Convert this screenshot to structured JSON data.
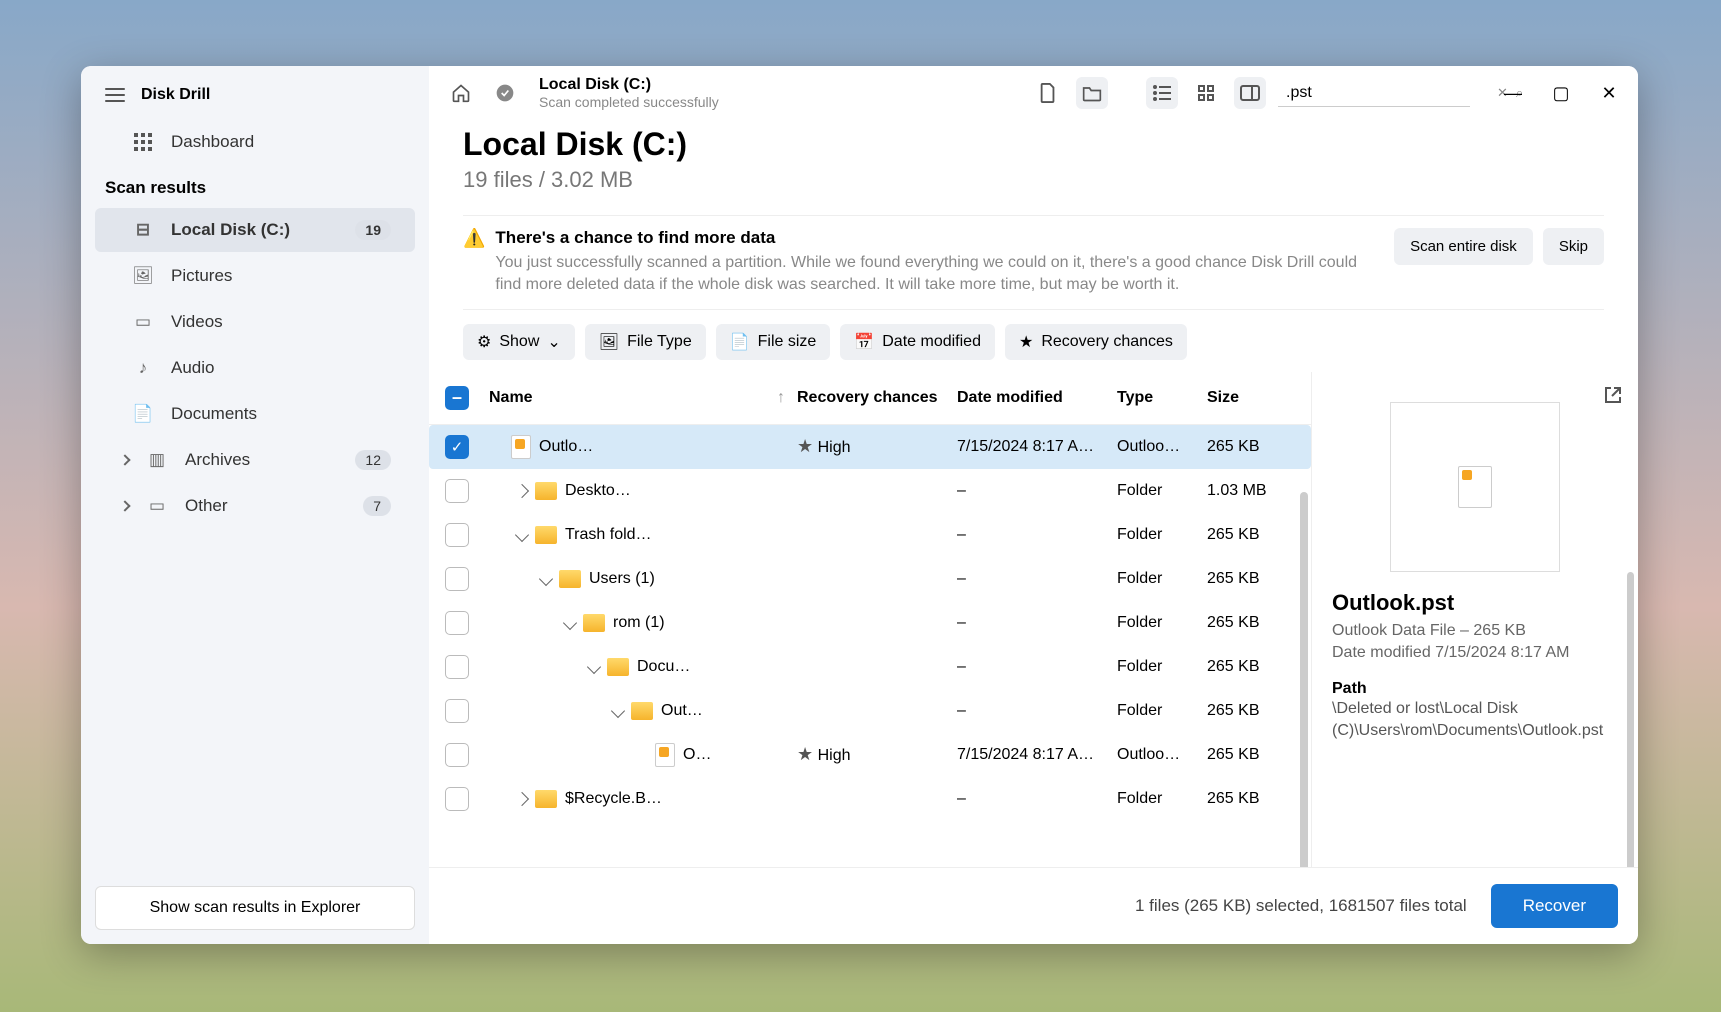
{
  "app": {
    "name": "Disk Drill"
  },
  "sidebar": {
    "dashboard": "Dashboard",
    "section": "Scan results",
    "items": [
      {
        "label": "Local Disk (C:)",
        "badge": "19",
        "selected": true,
        "icon": "disk"
      },
      {
        "label": "Pictures",
        "icon": "image"
      },
      {
        "label": "Videos",
        "icon": "video"
      },
      {
        "label": "Audio",
        "icon": "audio"
      },
      {
        "label": "Documents",
        "icon": "doc"
      },
      {
        "label": "Archives",
        "badge": "12",
        "chevron": true,
        "icon": "archive"
      },
      {
        "label": "Other",
        "badge": "7",
        "chevron": true,
        "icon": "other"
      }
    ],
    "footer_btn": "Show scan results in Explorer"
  },
  "toolbar": {
    "crumb_title": "Local Disk (C:)",
    "crumb_sub": "Scan completed successfully",
    "search_value": ".pst"
  },
  "header": {
    "title": "Local Disk (C:)",
    "subtitle": "19 files / 3.02 MB"
  },
  "banner": {
    "title": "There's a chance to find more data",
    "desc": "You just successfully scanned a partition. While we found everything we could on it, there's a good chance Disk Drill could find more deleted data if the whole disk was searched. It will take more time, but may be worth it.",
    "btn_primary": "Scan entire disk",
    "btn_secondary": "Skip"
  },
  "filters": {
    "show": "Show",
    "file_type": "File Type",
    "file_size": "File size",
    "date_modified": "Date modified",
    "recovery": "Recovery chances"
  },
  "columns": {
    "name": "Name",
    "recovery": "Recovery chances",
    "date": "Date modified",
    "type": "Type",
    "size": "Size"
  },
  "rows": [
    {
      "name": "Outlo…",
      "rec": "High",
      "date": "7/15/2024 8:17 A…",
      "type": "Outloo…",
      "size": "265 KB",
      "indent": 0,
      "kind": "file",
      "checked": true,
      "selected": true
    },
    {
      "name": "Deskto…",
      "rec": "",
      "date": "–",
      "type": "Folder",
      "size": "1.03 MB",
      "indent": 1,
      "kind": "folder",
      "arrow": "right"
    },
    {
      "name": "Trash fold…",
      "rec": "",
      "date": "–",
      "type": "Folder",
      "size": "265 KB",
      "indent": 1,
      "kind": "folder",
      "arrow": "down"
    },
    {
      "name": "Users (1)",
      "rec": "",
      "date": "–",
      "type": "Folder",
      "size": "265 KB",
      "indent": 2,
      "kind": "folder",
      "arrow": "down"
    },
    {
      "name": "rom (1)",
      "rec": "",
      "date": "–",
      "type": "Folder",
      "size": "265 KB",
      "indent": 3,
      "kind": "folder",
      "arrow": "down"
    },
    {
      "name": "Docu…",
      "rec": "",
      "date": "–",
      "type": "Folder",
      "size": "265 KB",
      "indent": 4,
      "kind": "folder",
      "arrow": "down"
    },
    {
      "name": "Out…",
      "rec": "",
      "date": "–",
      "type": "Folder",
      "size": "265 KB",
      "indent": 5,
      "kind": "folder",
      "arrow": "down"
    },
    {
      "name": "O…",
      "rec": "High",
      "date": "7/15/2024 8:17 A…",
      "type": "Outloo…",
      "size": "265 KB",
      "indent": 6,
      "kind": "file"
    },
    {
      "name": "$Recycle.B…",
      "rec": "",
      "date": "–",
      "type": "Folder",
      "size": "265 KB",
      "indent": 1,
      "kind": "folder",
      "arrow": "right"
    }
  ],
  "detail": {
    "title": "Outlook.pst",
    "meta1": "Outlook Data File – 265 KB",
    "meta2": "Date modified 7/15/2024 8:17 AM",
    "path_label": "Path",
    "path_value": "\\Deleted or lost\\Local Disk (C)\\Users\\rom\\Documents\\Outlook.pst"
  },
  "footer": {
    "status": "1 files (265 KB) selected, 1681507 files total",
    "recover": "Recover"
  }
}
